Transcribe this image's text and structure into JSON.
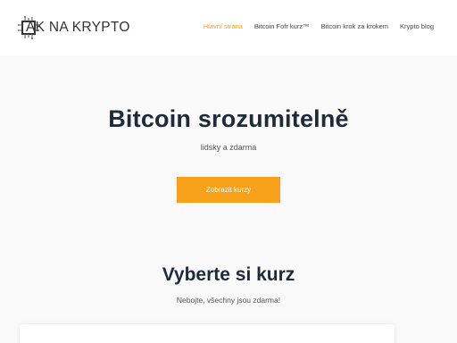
{
  "header": {
    "logo_text": "AK NA KRYPTO",
    "logo_icon": "circuit-chip-icon"
  },
  "nav": {
    "items": [
      {
        "label": "Hlavní strana",
        "active": true
      },
      {
        "label": "Bitcoin Fofr kurz™",
        "active": false
      },
      {
        "label": "Bitcoin krok za krokem",
        "active": false
      },
      {
        "label": "Krypto blog",
        "active": false
      }
    ]
  },
  "hero": {
    "title": "Bitcoin srozumitelně",
    "subtitle": "lidsky a zdarma",
    "cta_label": "Zobrazit kurzy"
  },
  "courses": {
    "title": "Vyberte si kurz",
    "subtitle": "Nebojte, všechny jsou zdarma!"
  },
  "colors": {
    "accent": "#f7a11a",
    "heading": "#1d2b3a",
    "background": "#f9f9f9"
  }
}
